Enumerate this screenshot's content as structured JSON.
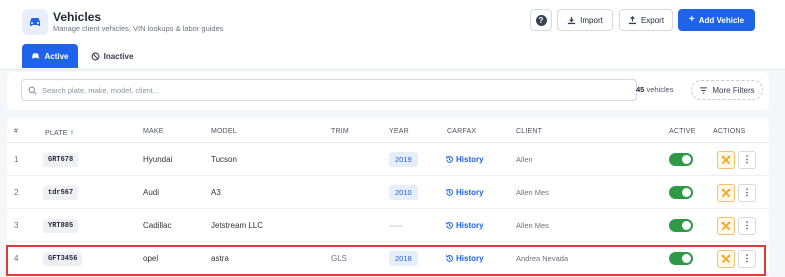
{
  "header": {
    "title": "Vehicles",
    "subtitle": "Manage client vehicles, VIN lookups & labor guides",
    "help_label": "?",
    "import_label": "Import",
    "export_label": "Export",
    "add_label": "Add Vehicle"
  },
  "tabs": [
    {
      "label": "Active",
      "active": true
    },
    {
      "label": "Inactive",
      "active": false
    }
  ],
  "filters": {
    "search_placeholder": "Search plate, make, model, client...",
    "count_value": "45",
    "count_unit": "vehicles",
    "more_filters_label": "More Filters"
  },
  "table": {
    "columns": [
      "#",
      "PLATE",
      "MAKE",
      "MODEL",
      "TRIM",
      "YEAR",
      "CARFAX",
      "CLIENT",
      "ACTIVE",
      "ACTIONS"
    ],
    "sort_indicator": "↑",
    "rows": [
      {
        "num": "1",
        "plate": "GRT678",
        "make": "Hyundai",
        "model": "Tucson",
        "trim": "",
        "year": "2019",
        "carfax": "History",
        "client": "Allen",
        "active": true
      },
      {
        "num": "2",
        "plate": "tdr567",
        "make": "Audi",
        "model": "A3",
        "trim": "",
        "year": "2010",
        "carfax": "History",
        "client": "Allen Mes",
        "active": true
      },
      {
        "num": "3",
        "plate": "YRT885",
        "make": "Cadillac",
        "model": "Jetstream LLC",
        "trim": "",
        "year": "",
        "carfax": "History",
        "client": "Allen Mes",
        "active": true
      },
      {
        "num": "4",
        "plate": "GFT3456",
        "make": "opel",
        "model": "astra",
        "trim": "GLS",
        "year": "2018",
        "carfax": "History",
        "client": "Andrea Nevada",
        "active": true
      }
    ]
  },
  "colors": {
    "primary": "#1e63e9",
    "toggle_on": "#2e9a47",
    "highlight": "#e03a3a",
    "tool_accent": "#f4a623"
  },
  "icons": {
    "app": "car-icon",
    "help": "question-icon",
    "import": "download-icon",
    "export": "upload-icon",
    "add": "plus-icon",
    "search": "search-icon",
    "filters": "filter-lines-icon",
    "carfax": "history-icon",
    "tool": "wrench-icon",
    "more": "kebab-icon"
  }
}
